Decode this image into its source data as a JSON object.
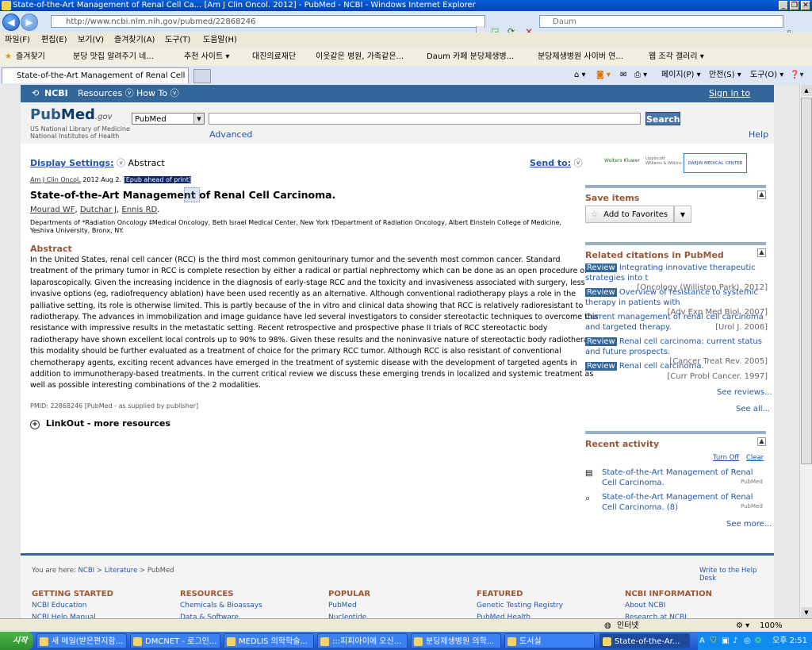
{
  "window": {
    "title": "State-of-the-Art Management of Renal Cell Ca... [Am J Clin Oncol. 2012] - PubMed - NCBI - Windows Internet Explorer",
    "minimize": "_",
    "restore": "❐",
    "close": "✕"
  },
  "browser": {
    "back": "◀",
    "forward": "▶",
    "url": "http://www.ncbi.nlm.nih.gov/pubmed/22868246",
    "search_placeholder": "Daum",
    "menu": [
      "파일(F)",
      "편집(E)",
      "보기(V)",
      "즐겨찾기(A)",
      "도구(T)",
      "도움말(H)"
    ],
    "favorites_label": "즐겨찾기",
    "favorites": [
      "분당 맛집 알려주기 네...",
      "추천 사이트 ▾",
      "대진의료재단",
      "이웃같은 병원, 가족같은...",
      "Daum 카페 분당제생병...",
      "분당제생병원 사이버 연...",
      "웹 조각 갤러리 ▾"
    ],
    "tab_title": "State-of-the-Art Management of Renal Cell C...",
    "toolbar_items": [
      "페이지(P) ▾",
      "안전(S) ▾",
      "도구(O) ▾"
    ],
    "status_zone": "인터넷",
    "zoom": "100%"
  },
  "ncbi": {
    "logo": "NCBI",
    "resources": "Resources ⓥ",
    "howto": "How To ⓥ",
    "signin": "Sign in to NCBI"
  },
  "pubmed": {
    "logo_pub": "Pub",
    "logo_med": "Med",
    "logo_gov": ".gov",
    "nlm_line1": "US National Library of Medicine",
    "nlm_line2": "National Institutes of Health",
    "db_select": "PubMed",
    "search_button": "Search",
    "advanced": "Advanced",
    "help": "Help"
  },
  "display_settings": {
    "label": "Display Settings:",
    "value": "Abstract",
    "send_to": "Send to:"
  },
  "sponsors": {
    "wk": "Wolters Kluwer",
    "lww": "Lippincott Williams & Wilkins",
    "djmc": "DAEJIN MEDICAL CENTER"
  },
  "article": {
    "journal": "Am J Clin Oncol.",
    "date": "2012 Aug 2.",
    "epub": "[Epub ahead of print]",
    "title": "State-of-the-Art Management of Renal Cell Carcinoma.",
    "authors": [
      "Mourad WF",
      "Dutchar J",
      "Ennis RD"
    ],
    "affiliation": "Departments of *Radiation Oncology ‡Medical Oncology, Beth Israel Medical Center, New York †Department of Radiation Oncology, Albert Einstein College of Medicine, Yeshiva University, Bronx, NY.",
    "abstract_heading": "Abstract",
    "abstract_lines": [
      "In the United States, renal cell cancer (RCC) is the third most common genitourinary tumor and the seventh most common cancer. Standard",
      "treatment of the primary tumor in RCC is complete resection by either a radical or partial nephrectomy which can be done as an open procedure or",
      "laparoscopically. Given the increasing incidence in the diagnosis of early-stage RCC and the toxicity and invasiveness associated with surgery, less",
      "invasive options (eg, radiofrequency ablation) have been used recently as an alternative. Although conventional radiotherapy plays a role in the",
      "palliative setting, its role is otherwise limited. This is partly because of the in vitro and clinical data showing that RCC is relatively radioresistant to",
      "radiotherapy. The advances in immobilization and image guidance have led several investigators to consider stereotactic techniques to overcome this",
      "resistance with impressive results in the metastatic setting. Recent retrospective and prospective phase II trials of RCC stereotactic body",
      "radiotherapy have shown excellent local controls up to 90% to 98%. Given these results and the noninvasive nature of stereotactic body radiotherapy",
      "this modality should be further evaluated as a treatment of choice for the primary RCC tumor. Although RCC is also resistant of conventional",
      "chemotherapy agents, exciting recent advances have emerged in the treatment of systemic disease with the development of targeted agents in",
      "addition to immunotherapy-based treatments. In the current critical review we discuss these emerging trends in localized and systemic treatment as",
      "well as possible interesting combinations of the 2 modalities."
    ],
    "pmid": "PMID: 22868246 [PubMed - as supplied by publisher]",
    "linkout": "LinkOut - more resources"
  },
  "sidebar": {
    "save_items": "Save items",
    "add_favorites": "Add to Favorites",
    "related_heading": "Related citations in PubMed",
    "related": [
      {
        "tag": "Review",
        "title": "Integrating innovative therapeutic strategies into t",
        "source": "[Oncology (Williston Park). 2012]"
      },
      {
        "tag": "Review",
        "title": "Overview of resistance to systemic therapy in patients with",
        "source": "[Adv Exp Med Biol. 2007]"
      },
      {
        "tag": "",
        "title": "Current management of renal cell carcinoma and targeted therapy.",
        "source": "[Urol J. 2006]"
      },
      {
        "tag": "Review",
        "title": "Renal cell carcinoma: current status and future prospects.",
        "source": "[Cancer Treat Rev. 2005]"
      },
      {
        "tag": "Review",
        "title": "Renal cell carcinoma.",
        "source": "[Curr Probl Cancer. 1997]"
      }
    ],
    "see_reviews": "See reviews...",
    "see_all": "See all...",
    "recent_heading": "Recent activity",
    "turn_off": "Turn Off",
    "clear": "Clear",
    "recent": [
      {
        "title": "State-of-the-Art Management of Renal Cell Carcinoma.",
        "db": "PubMed"
      },
      {
        "title": "State-of-the-Art Management of Renal Cell Carcinoma. (8)",
        "db": "PubMed"
      }
    ],
    "see_more": "See more..."
  },
  "footer": {
    "you_are_here": "You are here:",
    "crumbs": [
      "NCBI",
      "Literature",
      "PubMed"
    ],
    "write": "Write to the Help Desk",
    "columns": [
      {
        "heading": "GETTING STARTED",
        "items": [
          "NCBI Education",
          "NCBI Help Manual"
        ]
      },
      {
        "heading": "RESOURCES",
        "items": [
          "Chemicals & Bioassays",
          "Data & Software"
        ]
      },
      {
        "heading": "POPULAR",
        "items": [
          "PubMed",
          "Nucleotide"
        ]
      },
      {
        "heading": "FEATURED",
        "items": [
          "Genetic Testing Registry",
          "PubMed Health"
        ]
      },
      {
        "heading": "NCBI INFORMATION",
        "items": [
          "About NCBI",
          "Research at NCBI"
        ]
      }
    ]
  },
  "taskbar": {
    "start": "시작",
    "tasks": [
      "새 메일(받은편지함...",
      "DMCNET - 로그인...",
      "MEDLIS 의학학술...",
      ":::피피아이에 오신...",
      "분당제생병원 의학...",
      "도서실",
      "State-of-the-Ar..."
    ],
    "clock": "오후 2:51"
  }
}
